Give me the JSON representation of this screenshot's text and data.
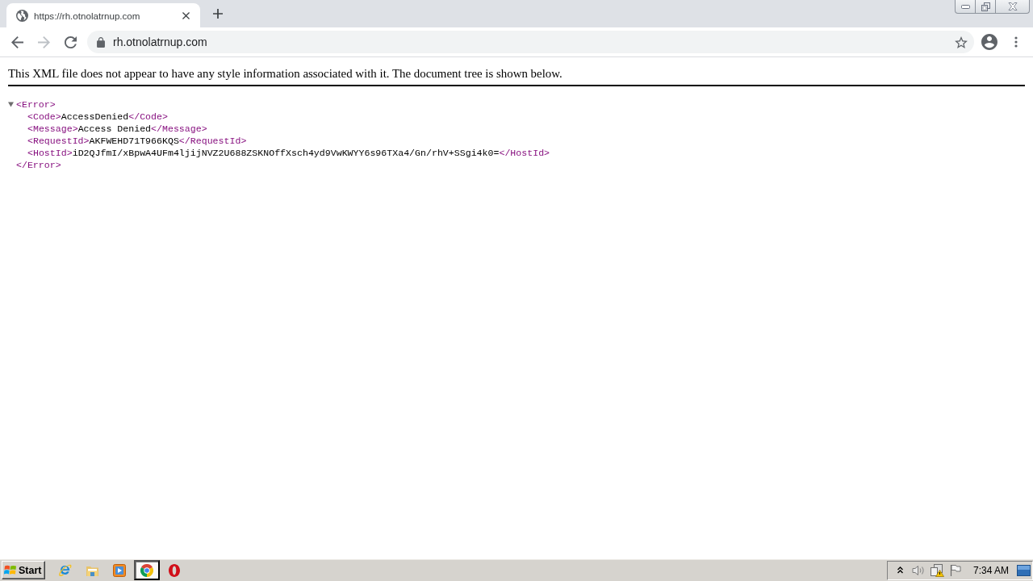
{
  "tabs": [
    {
      "title": "https://rh.otnolatrnup.com",
      "selected": true
    }
  ],
  "toolbar": {
    "back": {
      "disabled": false
    },
    "forward": {
      "disabled": true
    },
    "address_bar": {
      "url": "rh.otnolatrnup.com",
      "secure": true,
      "bookmarked": false
    }
  },
  "page": {
    "notice": "This XML file does not appear to have any style information associated with it. The document tree is shown below.",
    "xml_tree": {
      "open": "<Error>",
      "close": "</Error>",
      "expanded": true,
      "children": [
        {
          "open": "<Code>",
          "text": "AccessDenied",
          "close": "</Code>"
        },
        {
          "open": "<Message>",
          "text": "Access Denied",
          "close": "</Message>"
        },
        {
          "open": "<RequestId>",
          "text": "AKFWEHD71T966KQS",
          "close": "</RequestId>"
        },
        {
          "open": "<HostId>",
          "text": "iD2QJfmI/xBpwA4UFm4ljijNVZ2U688ZSKNOffXsch4yd9VwKWYY6s96TXa4/Gn/rhV+SSgi4k0=",
          "close": "</HostId>"
        }
      ]
    }
  },
  "taskbar": {
    "start": "Start",
    "apps": [
      {
        "kind": "e",
        "selected": false
      },
      {
        "kind": "folder",
        "selected": false
      },
      {
        "kind": "player",
        "selected": false
      },
      {
        "kind": "wheel",
        "selected": true
      },
      {
        "kind": "ring",
        "selected": false
      }
    ],
    "clock": "7:34 AM"
  }
}
